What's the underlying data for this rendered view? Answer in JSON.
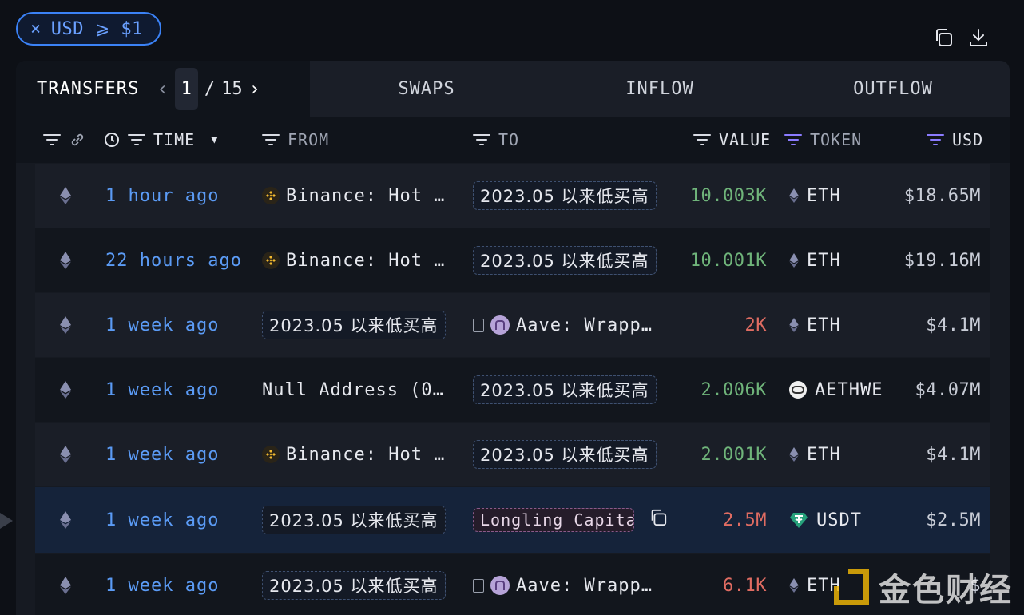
{
  "filter_chip": {
    "close": "×",
    "label": "USD ⩾ $1"
  },
  "tabs": {
    "transfers": "TRANSFERS",
    "page_current": "1",
    "page_sep": "/",
    "page_total": "15",
    "swaps": "SWAPS",
    "inflow": "INFLOW",
    "outflow": "OUTFLOW"
  },
  "columns": {
    "time": "TIME",
    "from": "FROM",
    "to": "TO",
    "value": "VALUE",
    "token": "TOKEN",
    "usd": "USD"
  },
  "rows": [
    {
      "time": "1 hour ago",
      "from": "Binance: Hot …",
      "to": "2023.05 以来低买高",
      "value": "10.003K",
      "token": "ETH",
      "usd": "$18.65M"
    },
    {
      "time": "22 hours ago",
      "from": "Binance: Hot …",
      "to": "2023.05 以来低买高",
      "value": "10.001K",
      "token": "ETH",
      "usd": "$19.16M"
    },
    {
      "time": "1 week ago",
      "from": "2023.05 以来低买高",
      "to": "Aave: Wrapp…",
      "value": "2K",
      "token": "ETH",
      "usd": "$4.1M"
    },
    {
      "time": "1 week ago",
      "from": "Null Address (0…",
      "to": "2023.05 以来低买高",
      "value": "2.006K",
      "token": "AETHWE",
      "usd": "$4.07M"
    },
    {
      "time": "1 week ago",
      "from": "Binance: Hot …",
      "to": "2023.05 以来低买高",
      "value": "2.001K",
      "token": "ETH",
      "usd": "$4.1M"
    },
    {
      "time": "1 week ago",
      "from": "2023.05 以来低买高",
      "to": "Longling Capita",
      "value": "2.5M",
      "token": "USDT",
      "usd": "$2.5M"
    },
    {
      "time": "1 week ago",
      "from": "2023.05 以来低买高",
      "to": "Aave: Wrapp…",
      "value": "6.1K",
      "token": "ETH",
      "usd": "$"
    }
  ],
  "watermark": "金色财经",
  "colors": {
    "accent": "#3b82f6",
    "positive": "#6fb47a",
    "negative": "#e06c62",
    "link": "#5b9bf5"
  }
}
